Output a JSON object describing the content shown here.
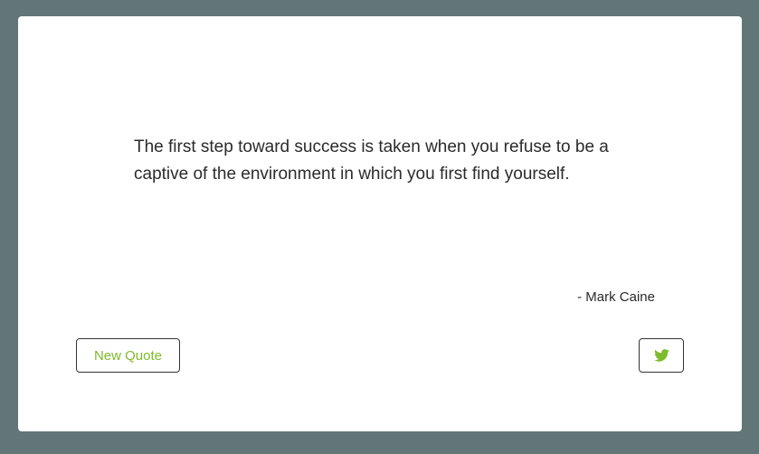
{
  "quote": {
    "text": "The first step toward success is taken when you refuse to be a captive of the environment in which you first find yourself.",
    "author": "- Mark Caine"
  },
  "buttons": {
    "new_quote_label": "New Quote",
    "tweet_icon": "twitter-icon"
  },
  "colors": {
    "background": "#637677",
    "card": "#ffffff",
    "accent": "#7cbb2a",
    "text": "#2b2b2b"
  }
}
